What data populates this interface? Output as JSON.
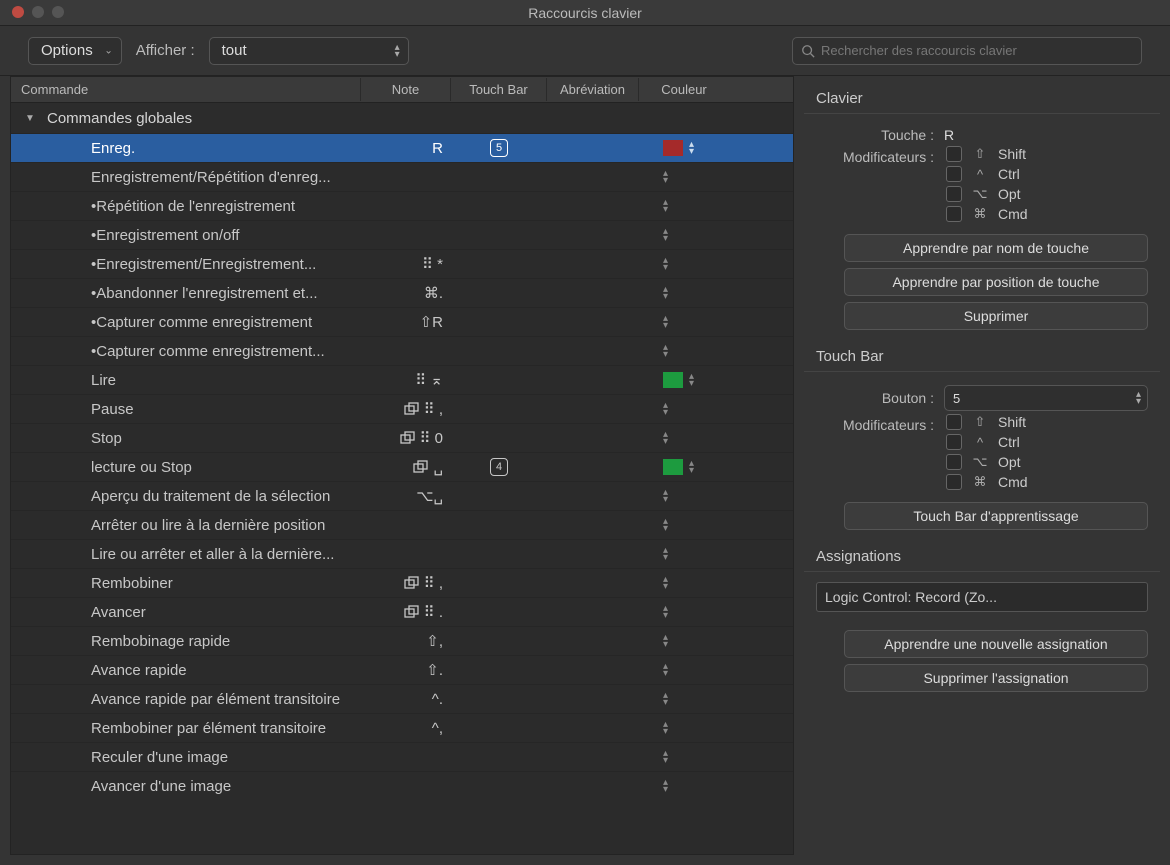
{
  "window_title": "Raccourcis clavier",
  "toolbar": {
    "options_label": "Options",
    "display_label": "Afficher :",
    "filter_value": "tout",
    "search_placeholder": "Rechercher des raccourcis clavier"
  },
  "table": {
    "headers": {
      "command": "Commande",
      "note": "Note",
      "touchbar": "Touch Bar",
      "abbrev": "Abréviation",
      "color": "Couleur"
    },
    "group_title": "Commandes globales",
    "rows": [
      {
        "label": "Enreg.",
        "note": "R",
        "tb": "5",
        "color": "red",
        "selected": true
      },
      {
        "label": "Enregistrement/Répétition d'enreg...",
        "note": "",
        "tb": "",
        "color": ""
      },
      {
        "label": "•Répétition de l'enregistrement",
        "note": "",
        "tb": "",
        "color": ""
      },
      {
        "label": "•Enregistrement on/off",
        "note": "",
        "tb": "",
        "color": ""
      },
      {
        "label": "•Enregistrement/Enregistrement...",
        "note": "⠿ *",
        "tb": "",
        "color": ""
      },
      {
        "label": "•Abandonner l'enregistrement et...",
        "note": "⌘.",
        "tb": "",
        "color": ""
      },
      {
        "label": "•Capturer comme enregistrement",
        "note": "⇧R",
        "tb": "",
        "color": ""
      },
      {
        "label": "•Capturer comme enregistrement...",
        "note": "",
        "tb": "",
        "color": ""
      },
      {
        "label": "Lire",
        "note": "⠿ ⌅",
        "tb": "",
        "color": "green"
      },
      {
        "label": "Pause",
        "note": "⠿ ,",
        "dup": true,
        "tb": "",
        "color": ""
      },
      {
        "label": "Stop",
        "note": "⠿ 0",
        "dup": true,
        "tb": "",
        "color": ""
      },
      {
        "label": "lecture ou Stop",
        "note": "␣",
        "dup": true,
        "tb": "4",
        "color": "green"
      },
      {
        "label": "Aperçu du traitement de la sélection",
        "note": "⌥␣",
        "tb": "",
        "color": ""
      },
      {
        "label": "Arrêter ou lire à la dernière position",
        "note": "",
        "tb": "",
        "color": ""
      },
      {
        "label": "Lire ou arrêter et aller à la dernière...",
        "note": "",
        "tb": "",
        "color": ""
      },
      {
        "label": "Rembobiner",
        "note": "⠿ ,",
        "dup": true,
        "tb": "",
        "color": ""
      },
      {
        "label": "Avancer",
        "note": "⠿ .",
        "dup": true,
        "tb": "",
        "color": ""
      },
      {
        "label": "Rembobinage rapide",
        "note": "⇧,",
        "tb": "",
        "color": ""
      },
      {
        "label": "Avance rapide",
        "note": "⇧.",
        "tb": "",
        "color": ""
      },
      {
        "label": "Avance rapide par élément transitoire",
        "note": "^.",
        "tb": "",
        "color": ""
      },
      {
        "label": "Rembobiner par élément transitoire",
        "note": "^,",
        "tb": "",
        "color": ""
      },
      {
        "label": "Reculer d'une image",
        "note": "",
        "tb": "",
        "color": ""
      },
      {
        "label": "Avancer d'une image",
        "note": "",
        "tb": "",
        "color": ""
      }
    ]
  },
  "panel": {
    "clavier": {
      "title": "Clavier",
      "key_label": "Touche :",
      "key_value": "R",
      "mod_label": "Modificateurs :",
      "mods": [
        {
          "sym": "⇧",
          "name": "Shift"
        },
        {
          "sym": "^",
          "name": "Ctrl"
        },
        {
          "sym": "⌥",
          "name": "Opt"
        },
        {
          "sym": "⌘",
          "name": "Cmd"
        }
      ],
      "learn_name": "Apprendre par nom de touche",
      "learn_pos": "Apprendre par position de touche",
      "delete": "Supprimer"
    },
    "touchbar": {
      "title": "Touch Bar",
      "button_label": "Bouton :",
      "button_value": "5",
      "mod_label": "Modificateurs :",
      "mods": [
        {
          "sym": "⇧",
          "name": "Shift"
        },
        {
          "sym": "^",
          "name": "Ctrl"
        },
        {
          "sym": "⌥",
          "name": "Opt"
        },
        {
          "sym": "⌘",
          "name": "Cmd"
        }
      ],
      "learn": "Touch Bar d'apprentissage"
    },
    "assign": {
      "title": "Assignations",
      "value": "Logic Control: Record (Zo...",
      "learn": "Apprendre une nouvelle assignation",
      "delete": "Supprimer l'assignation"
    }
  }
}
